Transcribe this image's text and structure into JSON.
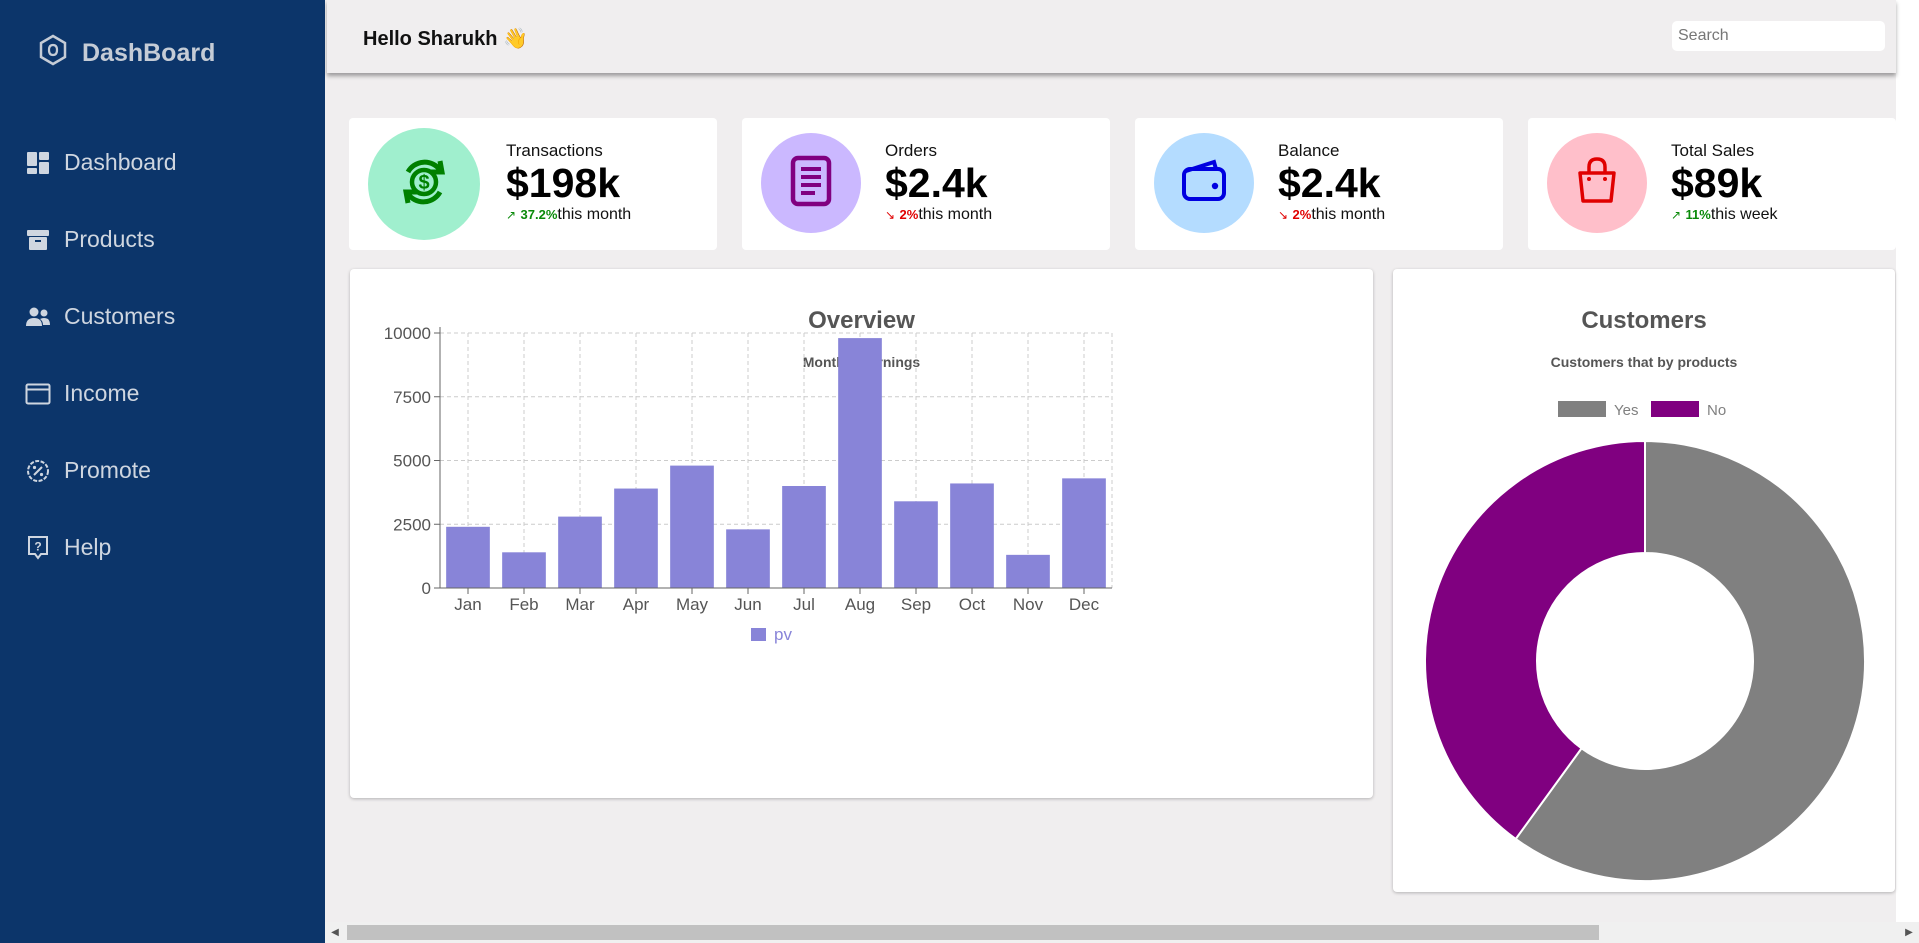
{
  "sidebar": {
    "brand": "DashBoard",
    "items": [
      {
        "label": "Dashboard",
        "icon": "dashboard-icon"
      },
      {
        "label": "Products",
        "icon": "archive-icon"
      },
      {
        "label": "Customers",
        "icon": "users-icon"
      },
      {
        "label": "Income",
        "icon": "window-icon"
      },
      {
        "label": "Promote",
        "icon": "badge-percent-icon"
      },
      {
        "label": "Help",
        "icon": "help-icon"
      }
    ]
  },
  "header": {
    "greeting": "Hello Sharukh 👋",
    "search_placeholder": "Search"
  },
  "cards": [
    {
      "label": "Transactions",
      "value": "$198k",
      "trend": "up",
      "percent": "37.2%",
      "period": "this month",
      "icon": "dollar-cycle-icon",
      "circle_color": "#a0efce",
      "icon_color": "#008000"
    },
    {
      "label": "Orders",
      "value": "$2.4k",
      "trend": "down",
      "percent": "2%",
      "period": "this month",
      "icon": "document-icon",
      "circle_color": "#cbb8ff",
      "icon_color": "#800080"
    },
    {
      "label": "Balance",
      "value": "$2.4k",
      "trend": "down",
      "percent": "2%",
      "period": "this month",
      "icon": "wallet-icon",
      "circle_color": "#b4dcff",
      "icon_color": "#0000e0"
    },
    {
      "label": "Total Sales",
      "value": "$89k",
      "trend": "up",
      "percent": "11%",
      "period": "this week",
      "icon": "shopping-bag-icon",
      "circle_color": "#ffbfca",
      "icon_color": "#e00000"
    }
  ],
  "overview": {
    "title": "Overview",
    "subtitle": "Monthly Earnings"
  },
  "customers_panel": {
    "title": "Customers",
    "subtitle": "Customers that by products"
  },
  "chart_data": [
    {
      "type": "bar",
      "title": "Overview",
      "subtitle": "Monthly Earnings",
      "categories": [
        "Jan",
        "Feb",
        "Mar",
        "Apr",
        "May",
        "Jun",
        "Jul",
        "Aug",
        "Sep",
        "Oct",
        "Nov",
        "Dec"
      ],
      "series": [
        {
          "name": "pv",
          "values": [
            2400,
            1400,
            2800,
            3900,
            4800,
            2300,
            4000,
            9800,
            3400,
            4100,
            1300,
            4300
          ],
          "color": "#8884d8"
        }
      ],
      "yticks": [
        "0",
        "2500",
        "5000",
        "7500",
        "10000"
      ],
      "ylim": [
        0,
        10000
      ],
      "grid": true,
      "legend": "bottom"
    },
    {
      "type": "pie",
      "title": "Customers",
      "subtitle": "Customers that by products",
      "donut": true,
      "slices": [
        {
          "name": "Yes",
          "value": 60,
          "color": "#808080"
        },
        {
          "name": "No",
          "value": 40,
          "color": "#800080"
        }
      ],
      "legend": "top"
    }
  ]
}
